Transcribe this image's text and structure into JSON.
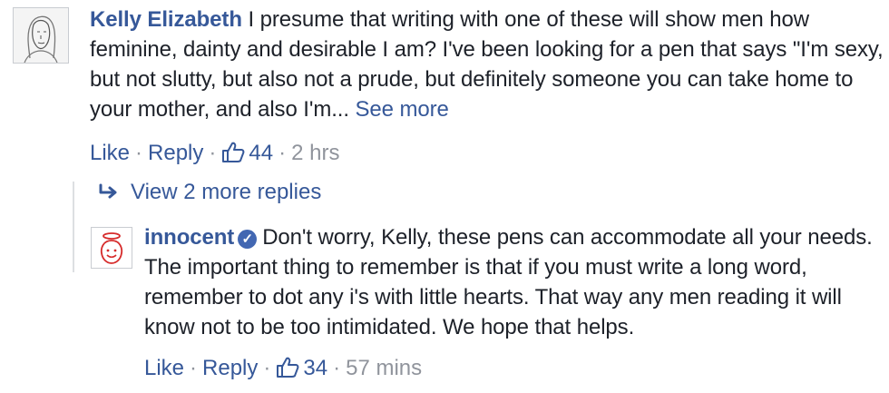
{
  "comments": {
    "kelly": {
      "author": "Kelly Elizabeth",
      "text": "I presume that writing with one of these will show men how feminine, dainty and desirable I am? I've been looking for a pen that says \"I'm sexy, but not slutty, but also not a prude, but definitely someone you can take home to your mother, and also I'm...",
      "see_more": "See more",
      "like_label": "Like",
      "reply_label": "Reply",
      "like_count": "44",
      "timestamp": "2 hrs"
    },
    "more_replies": "View 2 more replies",
    "innocent": {
      "author": "innocent",
      "text": "Don't worry, Kelly, these pens can accommodate all your needs. The important thing to remember is that if you must write a long word, remember to dot any i's with little hearts. That way any men reading it will know not to be too intimidated. We hope that helps.",
      "like_label": "Like",
      "reply_label": "Reply",
      "like_count": "34",
      "timestamp": "57 mins"
    }
  },
  "icons": {
    "like": "thumbs-up-icon",
    "verified": "verified-badge-icon",
    "reply": "reply-arrow-icon"
  },
  "colors": {
    "link": "#365899",
    "meta": "#90949c",
    "verified": "#4267b2",
    "brand_red": "#d62b2b"
  }
}
